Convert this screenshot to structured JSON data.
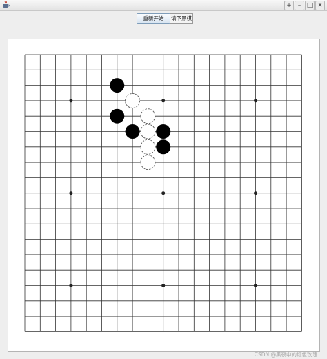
{
  "window": {
    "icon": "java-coffee-cup-icon",
    "controls": [
      "minimize-icon",
      "maximize-icon",
      "restore-icon",
      "close-icon"
    ],
    "control_glyphs": [
      "+",
      "–",
      "□",
      "✕"
    ]
  },
  "toolbar": {
    "restart_label": "重新开始",
    "status_text": "请下黑棋"
  },
  "board": {
    "size": 19,
    "star_points": [
      [
        3,
        3
      ],
      [
        9,
        3
      ],
      [
        15,
        3
      ],
      [
        3,
        9
      ],
      [
        9,
        9
      ],
      [
        15,
        9
      ],
      [
        3,
        15
      ],
      [
        9,
        15
      ],
      [
        15,
        15
      ]
    ],
    "stones": [
      {
        "col": 6,
        "row": 2,
        "color": "black"
      },
      {
        "col": 7,
        "row": 3,
        "color": "white"
      },
      {
        "col": 6,
        "row": 4,
        "color": "black"
      },
      {
        "col": 8,
        "row": 4,
        "color": "white"
      },
      {
        "col": 7,
        "row": 5,
        "color": "black"
      },
      {
        "col": 8,
        "row": 5,
        "color": "white"
      },
      {
        "col": 9,
        "row": 5,
        "color": "black"
      },
      {
        "col": 8,
        "row": 6,
        "color": "white"
      },
      {
        "col": 9,
        "row": 6,
        "color": "black"
      },
      {
        "col": 8,
        "row": 7,
        "color": "white"
      }
    ]
  },
  "watermark": "CSDN @黑夜中的红色玫瑰"
}
